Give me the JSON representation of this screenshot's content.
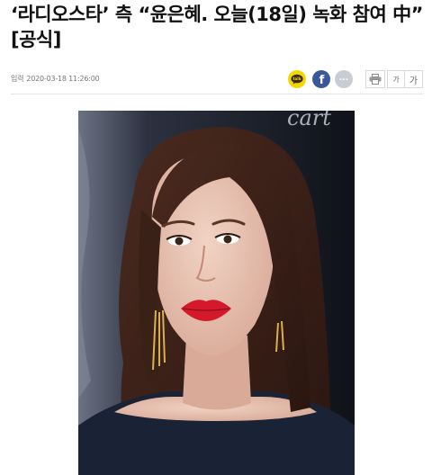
{
  "article": {
    "headline": "‘라디오스타’ 측 “윤은혜. 오늘(18일) 녹화 참여 中” [공식]",
    "published_label": "입력",
    "published_time": "2020-03-18 11:26:00"
  },
  "share": {
    "kakao_icon_text": "talk",
    "facebook_icon_text": "f",
    "more_icon_text": "···"
  },
  "tools": {
    "font_small": "가",
    "font_large": "가"
  },
  "photo": {
    "backdrop_text": "cart"
  }
}
